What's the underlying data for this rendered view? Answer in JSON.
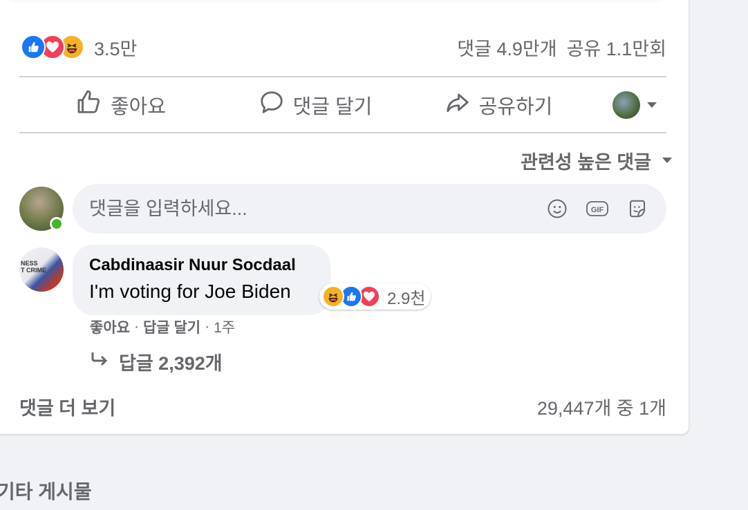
{
  "post": {
    "reaction_count": "3.5만",
    "comment_count": "댓글 4.9만개",
    "share_count": "공유 1.1만회",
    "reaction_icons": [
      "like-icon",
      "love-icon",
      "haha-icon"
    ]
  },
  "actions": {
    "like": "좋아요",
    "comment": "댓글 달기",
    "share": "공유하기"
  },
  "sort": {
    "label": "관련성 높은 댓글"
  },
  "composer": {
    "placeholder": "댓글을 입력하세요...",
    "gif_label": "GIF"
  },
  "comment": {
    "author": "Cabdinaasir Nuur Socdaal",
    "text": "I'm voting for Joe Biden",
    "reaction_count": "2.9천",
    "like_link": "좋아요",
    "reply_link": "답글 달기",
    "time": "1주",
    "replies": "답글 2,392개",
    "avatar_text": "NESS\nT CRIME"
  },
  "footer": {
    "more_comments": "댓글 더 보기",
    "pagination": "29,447개 중 1개"
  },
  "other_posts": "기타 게시물",
  "colors": {
    "like_blue": "#1877f2",
    "love_red": "#f33e58",
    "haha_yellow": "#f7b125",
    "online_green": "#42b72a",
    "secondary_text": "#65676b"
  }
}
